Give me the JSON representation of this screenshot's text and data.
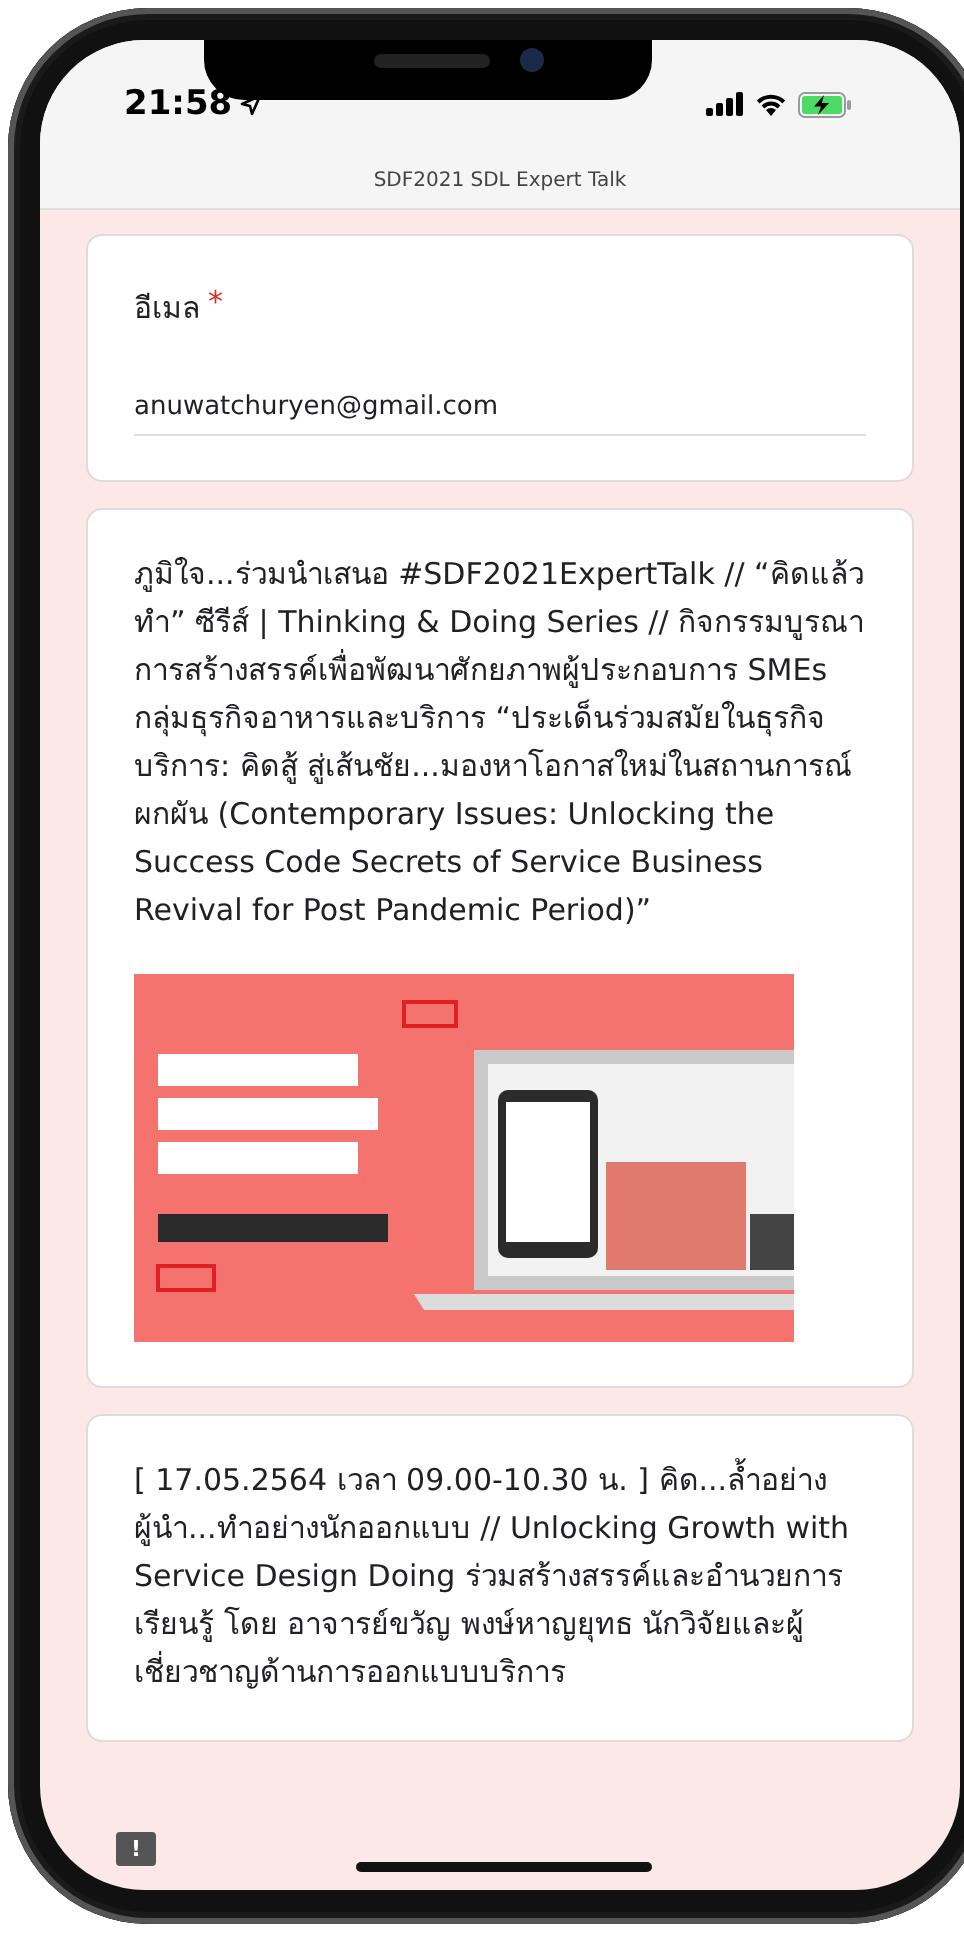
{
  "status_bar": {
    "time": "21:58"
  },
  "header": {
    "title": "SDF2021 SDL Expert Talk"
  },
  "email_question": {
    "label": "อีเมล",
    "required_mark": "*",
    "value": "anuwatchuryen@gmail.com"
  },
  "sections": [
    {
      "text": "ภูมิใจ...ร่วมนำเสนอ #SDF2021ExpertTalk // “คิดแล้วทำ” ซีรีส์ | Thinking & Doing Series // กิจกรรมบูรณาการสร้างสรรค์เพื่อพัฒนาศักยภาพผู้ประกอบการ SMEs กลุ่มธุรกิจอาหารและบริการ “ประเด็นร่วมสมัยในธุรกิจบริการ: คิดสู้ สู่เส้นชัย...มองหาโอกาสใหม่ในสถานการณ์ผกผัน (Contemporary Issues: Unlocking the Success Code Secrets of Service Business Revival for Post Pandemic Period)”",
      "kind": "picture"
    },
    {
      "text": "[ 17.05.2564 เวลา 09.00-10.30 น. ] คิด...ล้ำอย่างผู้นำ...ทำอย่างนักออกแบบ // Unlocking Growth with Service Design Doing ร่วมสร้างสรรค์และอำนวยการเรียนรู้ โดย อาจารย์ขวัญ พงษ์หาญยุทธ นักวิจัยและผู้เชี่ยวชาญด้านการออกแบบบริการ",
      "kind": "text"
    }
  ],
  "feedback_button": "!"
}
